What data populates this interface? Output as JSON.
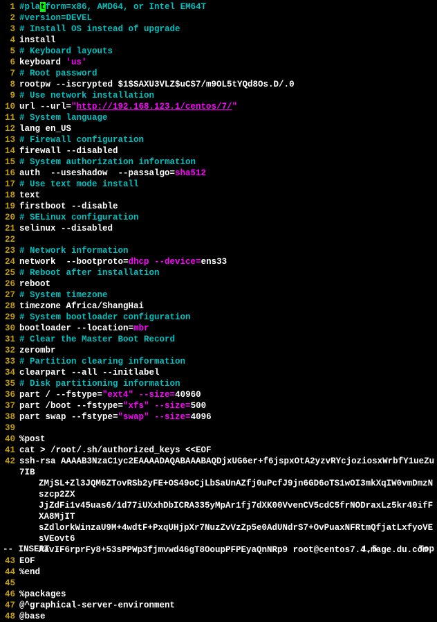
{
  "status": {
    "mode": "-- INSERT --",
    "position": "1,5",
    "scroll": "Top"
  },
  "cursor": {
    "line": 1,
    "col": 5
  },
  "lines": [
    {
      "n": 1,
      "segs": [
        {
          "c": "comment",
          "t": "#pla"
        },
        {
          "c": "cursor",
          "t": "t"
        },
        {
          "c": "comment",
          "t": "form=x86, AMD64, or Intel EM64T"
        }
      ]
    },
    {
      "n": 2,
      "segs": [
        {
          "c": "comment",
          "t": "#version=DEVEL"
        }
      ]
    },
    {
      "n": 3,
      "segs": [
        {
          "c": "comment",
          "t": "# Install OS instead of upgrade"
        }
      ]
    },
    {
      "n": 4,
      "segs": [
        {
          "c": "",
          "t": "install"
        }
      ]
    },
    {
      "n": 5,
      "segs": [
        {
          "c": "comment",
          "t": "# Keyboard layouts"
        }
      ]
    },
    {
      "n": 6,
      "segs": [
        {
          "c": "",
          "t": "keyboard "
        },
        {
          "c": "string",
          "t": "'us'"
        }
      ]
    },
    {
      "n": 7,
      "segs": [
        {
          "c": "comment",
          "t": "# Root password"
        }
      ]
    },
    {
      "n": 8,
      "segs": [
        {
          "c": "",
          "t": "rootpw --iscrypted $1$SAXU3VLZ$uCS7/m9OL5tYQd8Os.D/.0"
        }
      ]
    },
    {
      "n": 9,
      "segs": [
        {
          "c": "comment",
          "t": "# Use network installation"
        }
      ]
    },
    {
      "n": 10,
      "segs": [
        {
          "c": "",
          "t": "url --url="
        },
        {
          "c": "string",
          "t": "\""
        },
        {
          "c": "url",
          "t": "http://192.168.123.1/centos/7/"
        },
        {
          "c": "string",
          "t": "\""
        }
      ]
    },
    {
      "n": 11,
      "segs": [
        {
          "c": "comment",
          "t": "# System language"
        }
      ]
    },
    {
      "n": 12,
      "segs": [
        {
          "c": "",
          "t": "lang en_US"
        }
      ]
    },
    {
      "n": 13,
      "segs": [
        {
          "c": "comment",
          "t": "# Firewall configuration"
        }
      ]
    },
    {
      "n": 14,
      "segs": [
        {
          "c": "",
          "t": "firewall --disabled"
        }
      ]
    },
    {
      "n": 15,
      "segs": [
        {
          "c": "comment",
          "t": "# System authorization information"
        }
      ]
    },
    {
      "n": 16,
      "segs": [
        {
          "c": "",
          "t": "auth  --useshadow  --passalgo="
        },
        {
          "c": "string",
          "t": "sha512"
        }
      ]
    },
    {
      "n": 17,
      "segs": [
        {
          "c": "comment",
          "t": "# Use text mode install"
        }
      ]
    },
    {
      "n": 18,
      "segs": [
        {
          "c": "",
          "t": "text"
        }
      ]
    },
    {
      "n": 19,
      "segs": [
        {
          "c": "",
          "t": "firstboot --disable"
        }
      ]
    },
    {
      "n": 20,
      "segs": [
        {
          "c": "comment",
          "t": "# SELinux configuration"
        }
      ]
    },
    {
      "n": 21,
      "segs": [
        {
          "c": "",
          "t": "selinux --disabled"
        }
      ]
    },
    {
      "n": 22,
      "segs": []
    },
    {
      "n": 23,
      "segs": [
        {
          "c": "comment",
          "t": "# Network information"
        }
      ]
    },
    {
      "n": 24,
      "segs": [
        {
          "c": "",
          "t": "network  --bootproto="
        },
        {
          "c": "string",
          "t": "dhcp --device="
        },
        {
          "c": "",
          "t": "ens33"
        }
      ]
    },
    {
      "n": 25,
      "segs": [
        {
          "c": "comment",
          "t": "# Reboot after installation"
        }
      ]
    },
    {
      "n": 26,
      "segs": [
        {
          "c": "",
          "t": "reboot"
        }
      ]
    },
    {
      "n": 27,
      "segs": [
        {
          "c": "comment",
          "t": "# System timezone"
        }
      ]
    },
    {
      "n": 28,
      "segs": [
        {
          "c": "",
          "t": "timezone Africa/ShangHai"
        }
      ]
    },
    {
      "n": 29,
      "segs": [
        {
          "c": "comment",
          "t": "# System bootloader configuration"
        }
      ]
    },
    {
      "n": 30,
      "segs": [
        {
          "c": "",
          "t": "bootloader --location="
        },
        {
          "c": "string",
          "t": "mbr"
        }
      ]
    },
    {
      "n": 31,
      "segs": [
        {
          "c": "comment",
          "t": "# Clear the Master Boot Record"
        }
      ]
    },
    {
      "n": 32,
      "segs": [
        {
          "c": "",
          "t": "zerombr"
        }
      ]
    },
    {
      "n": 33,
      "segs": [
        {
          "c": "comment",
          "t": "# Partition clearing information"
        }
      ]
    },
    {
      "n": 34,
      "segs": [
        {
          "c": "",
          "t": "clearpart --all --initlabel"
        }
      ]
    },
    {
      "n": 35,
      "segs": [
        {
          "c": "comment",
          "t": "# Disk partitioning information"
        }
      ]
    },
    {
      "n": 36,
      "segs": [
        {
          "c": "",
          "t": "part / --fstype="
        },
        {
          "c": "string",
          "t": "\"ext4\" --size="
        },
        {
          "c": "",
          "t": "40960"
        }
      ]
    },
    {
      "n": 37,
      "segs": [
        {
          "c": "",
          "t": "part /boot --fstype="
        },
        {
          "c": "string",
          "t": "\"xfs\" --size="
        },
        {
          "c": "",
          "t": "500"
        }
      ]
    },
    {
      "n": 38,
      "segs": [
        {
          "c": "",
          "t": "part swap --fstype="
        },
        {
          "c": "string",
          "t": "\"swap\" --size="
        },
        {
          "c": "",
          "t": "4096"
        }
      ]
    },
    {
      "n": 39,
      "segs": []
    },
    {
      "n": 40,
      "segs": [
        {
          "c": "",
          "t": "%post"
        }
      ]
    },
    {
      "n": 41,
      "segs": [
        {
          "c": "",
          "t": "cat > /root/.sh/authorized_keys <<EOF"
        }
      ]
    },
    {
      "n": 42,
      "segs": [
        {
          "c": "",
          "t": "ssh-rsa AAAAB3NzaC1yc2EAAAADAQABAAABAQDjxUG6er+f6jspxOtA2yzvRYcjoziosxWrbfY1ueZu7IB"
        }
      ],
      "cont": [
        "ZMjSL+Zl3JQM6ZTovRSb2yFE+OS49oCjLbSaUnAZfj0uPcfJ9jn6GD6oTS1wOI3mkXqIW0vmDmzNszcp2ZX",
        "JjZdFi1v45uas6/1d77iUXxhDbICRA335yMpAr1fj7dXK00VvenCV5cdC5frNODraxLz5kr40ifFXA8MjIT",
        "sZdlorkWinzaU9M+4wdtF+PxqUHjpXr7NuzZvVzZp5e0AdUNdrS7+OvPuaxNFRtmQfjatLxfyoVEsVEovt6",
        "AavIF6rprFy8+53sPPWp3fjmvwd46gT8OoupPFPEyaQnNRp9 root@centos7.4.mage.du.com"
      ]
    },
    {
      "n": 43,
      "segs": [
        {
          "c": "",
          "t": "EOF"
        }
      ]
    },
    {
      "n": 44,
      "segs": [
        {
          "c": "",
          "t": "%end"
        }
      ]
    },
    {
      "n": 45,
      "segs": []
    },
    {
      "n": 46,
      "segs": [
        {
          "c": "",
          "t": "%packages"
        }
      ]
    },
    {
      "n": 47,
      "segs": [
        {
          "c": "",
          "t": "@^graphical-server-environment"
        }
      ]
    },
    {
      "n": 48,
      "segs": [
        {
          "c": "",
          "t": "@base"
        }
      ]
    }
  ]
}
